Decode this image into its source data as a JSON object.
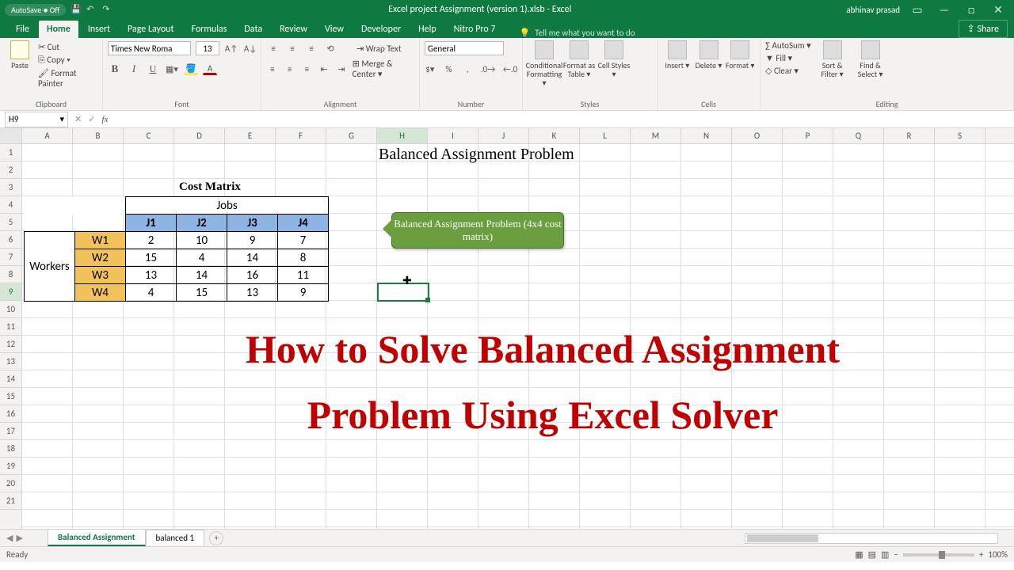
{
  "titlebar": {
    "autosave": "AutoSave ● Off",
    "doc_title": "Excel project Assignment (version 1).xlsb - Excel",
    "user": "abhinav prasad"
  },
  "tabs": {
    "items": [
      "File",
      "Home",
      "Insert",
      "Page Layout",
      "Formulas",
      "Data",
      "Review",
      "View",
      "Developer",
      "Help",
      "Nitro Pro 7"
    ],
    "active": "Home",
    "tellme": "Tell me what you want to do",
    "share": "Share"
  },
  "ribbon": {
    "clipboard": {
      "label": "Clipboard",
      "paste": "Paste",
      "cut": "Cut",
      "copy": "Copy ▾",
      "painter": "Format Painter"
    },
    "font": {
      "label": "Font",
      "name": "Times New Roma",
      "size": "13",
      "b": "B",
      "i": "I",
      "u": "U"
    },
    "alignment": {
      "label": "Alignment",
      "wrap": "Wrap Text",
      "merge": "Merge & Center ▾"
    },
    "number": {
      "label": "Number",
      "format": "General"
    },
    "styles": {
      "label": "Styles",
      "cond": "Conditional Formatting ▾",
      "fat": "Format as Table ▾",
      "cell": "Cell Styles ▾"
    },
    "cells": {
      "label": "Cells",
      "insert": "Insert ▾",
      "delete": "Delete ▾",
      "format": "Format ▾"
    },
    "editing": {
      "label": "Editing",
      "autosum": "AutoSum ▾",
      "fill": "Fill ▾",
      "clear": "Clear ▾",
      "sort": "Sort & Filter ▾",
      "find": "Find & Select ▾"
    }
  },
  "namebox": "H9",
  "columns": [
    "A",
    "B",
    "C",
    "D",
    "E",
    "F",
    "G",
    "H",
    "I",
    "J",
    "K",
    "L",
    "M",
    "N",
    "O",
    "P",
    "Q",
    "R",
    "S"
  ],
  "rows_visible": 21,
  "selected_col": "H",
  "selected_row": 9,
  "sheet": {
    "title": "Balanced Assignment Problem",
    "matrix_label": "Cost Matrix",
    "jobs_label": "Jobs",
    "workers_label": "Workers",
    "job_headers": [
      "J1",
      "J2",
      "J3",
      "J4"
    ],
    "worker_headers": [
      "W1",
      "W2",
      "W3",
      "W4"
    ],
    "values": [
      [
        2,
        10,
        9,
        7
      ],
      [
        15,
        4,
        14,
        8
      ],
      [
        13,
        14,
        16,
        11
      ],
      [
        4,
        15,
        13,
        9
      ]
    ],
    "callout": "Balanced Assignment Problem (4x4 cost matrix)"
  },
  "overlay": {
    "line1": "How to Solve Balanced Assignment",
    "line2": "Problem Using Excel Solver"
  },
  "sheets": {
    "items": [
      "Balanced Assignment",
      "balanced 1"
    ],
    "active": "Balanced Assignment"
  },
  "status": {
    "ready": "Ready",
    "zoom": "100%"
  }
}
